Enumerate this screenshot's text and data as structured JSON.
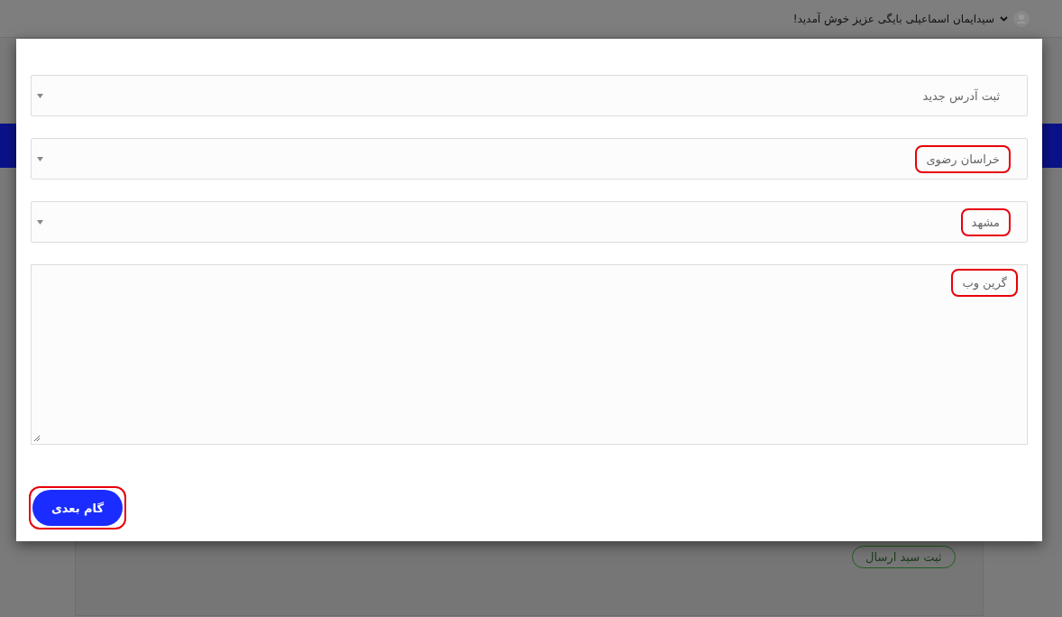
{
  "header": {
    "greeting": "سیدایمان اسماعیلی بایگی عزیز خوش آمدید!"
  },
  "background": {
    "button": "ثبت سبد ارسال"
  },
  "dialog": {
    "fields": [
      {
        "kind": "select",
        "value": "ثبت آدرس جدید",
        "highlighted": false
      },
      {
        "kind": "select",
        "value": "خراسان رضوی",
        "highlighted": true
      },
      {
        "kind": "select",
        "value": "مشهد",
        "highlighted": true
      },
      {
        "kind": "textarea",
        "value": "گرین وب",
        "highlighted": true
      }
    ],
    "button": {
      "label": "گام بعدی",
      "highlighted": true
    }
  }
}
